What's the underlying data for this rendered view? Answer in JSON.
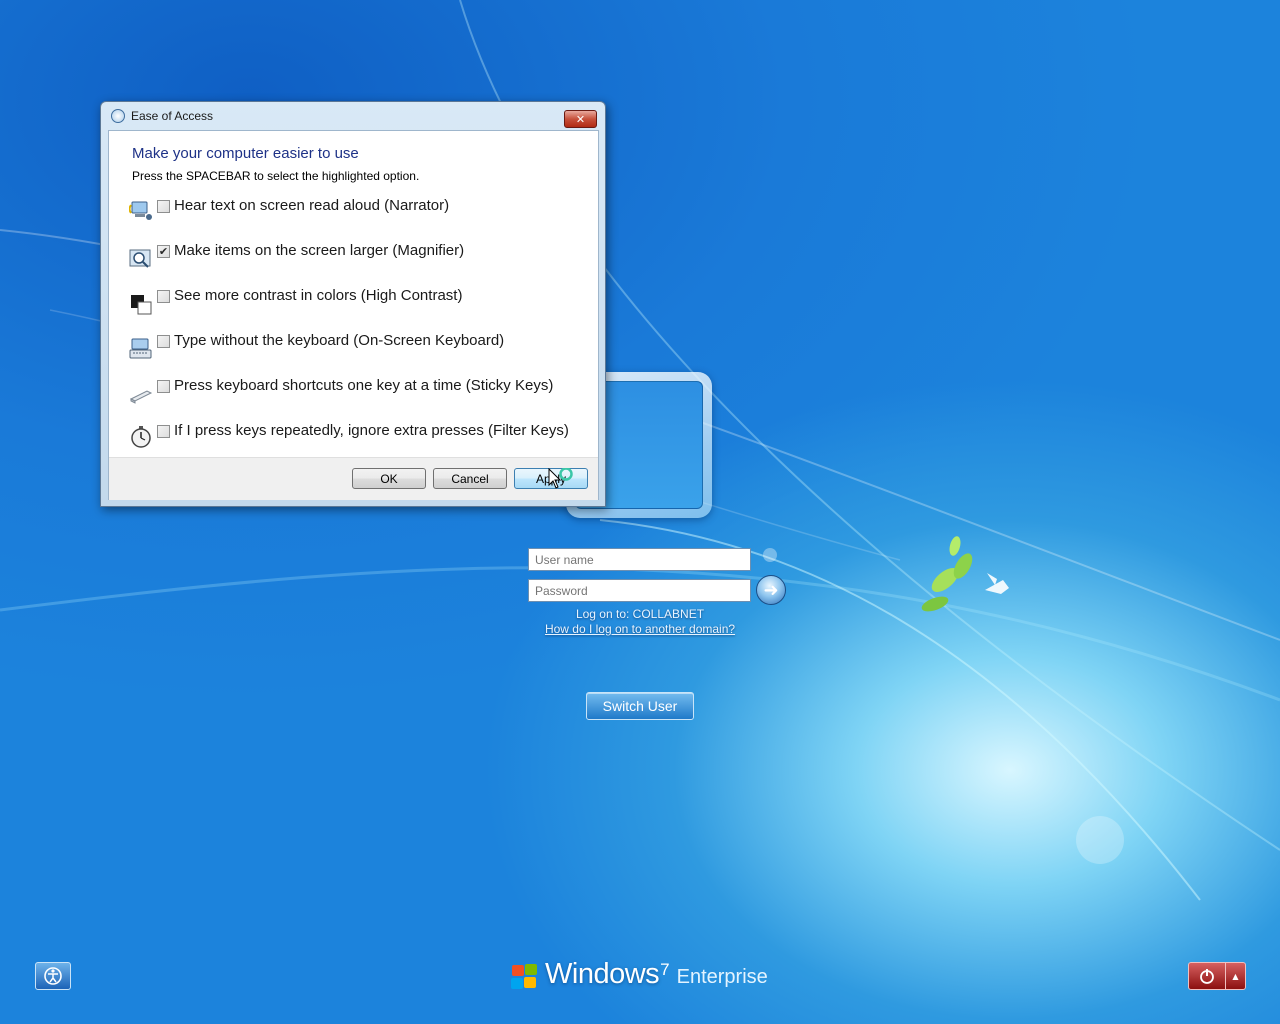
{
  "dialog": {
    "title": "Ease of Access",
    "close_label": "✕",
    "heading": "Make your computer easier to use",
    "instruction": "Press the SPACEBAR to select the highlighted option.",
    "options": [
      {
        "label": "Hear text on screen read aloud (Narrator)",
        "checked": false,
        "icon": "narrator-icon"
      },
      {
        "label": "Make items on the screen larger (Magnifier)",
        "checked": true,
        "icon": "magnifier-icon"
      },
      {
        "label": "See more contrast in colors (High Contrast)",
        "checked": false,
        "icon": "high-contrast-icon"
      },
      {
        "label": "Type without the keyboard (On-Screen Keyboard)",
        "checked": false,
        "icon": "keyboard-icon"
      },
      {
        "label": "Press keyboard shortcuts one key at a time (Sticky Keys)",
        "checked": false,
        "icon": "sticky-keys-icon"
      },
      {
        "label": "If I press keys repeatedly, ignore extra presses (Filter Keys)",
        "checked": false,
        "icon": "stopwatch-icon"
      }
    ],
    "buttons": {
      "ok": "OK",
      "cancel": "Cancel",
      "apply": "Apply"
    }
  },
  "login": {
    "username_placeholder": "User name",
    "password_placeholder": "Password",
    "logon_to": "Log on to: COLLABNET",
    "other_domain_link": "How do I log on to another domain?",
    "switch_user": "Switch User"
  },
  "branding": {
    "name": "Windows",
    "version": "7",
    "edition": "Enterprise"
  },
  "colors": {
    "background": "#1877d6",
    "heading": "#1e3287",
    "power_button": "#b02020"
  }
}
